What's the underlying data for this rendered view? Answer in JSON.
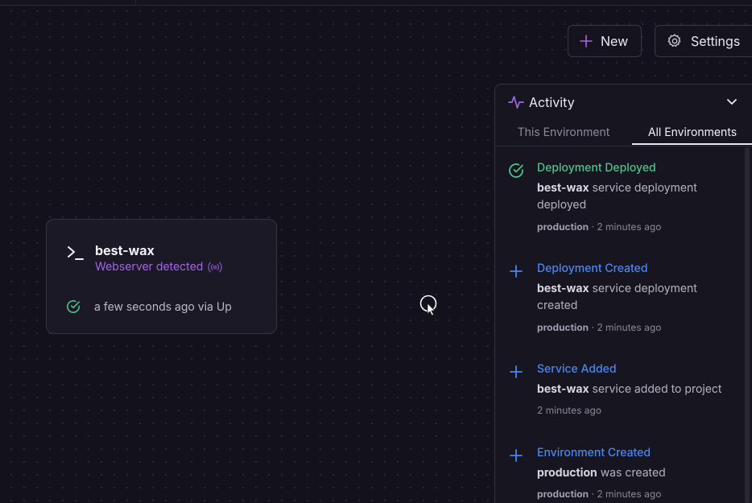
{
  "toolbar": {
    "new_label": "New",
    "settings_label": "Settings"
  },
  "service_card": {
    "name": "best-wax",
    "subtitle": "Webserver detected",
    "status_text": "a few seconds ago via Up",
    "icons": [
      "terminal-icon",
      "broadcast-icon",
      "check-circle-icon"
    ]
  },
  "activity": {
    "title": "Activity",
    "tabs": [
      {
        "label": "This Environment",
        "active": false
      },
      {
        "label": "All Environments",
        "active": true
      }
    ],
    "events": [
      {
        "icon": "check-circle-icon",
        "title": "Deployment Deployed",
        "subject": "best-wax",
        "text": "service deployment deployed",
        "env": "production",
        "time": "2 minutes ago"
      },
      {
        "icon": "plus-icon",
        "title": "Deployment Created",
        "subject": "best-wax",
        "text": "service deployment created",
        "env": "production",
        "time": "2 minutes ago"
      },
      {
        "icon": "plus-icon",
        "title": "Service Added",
        "subject": "best-wax",
        "text": "service added to project",
        "env": "",
        "time": "2 minutes ago"
      },
      {
        "icon": "plus-icon",
        "title": "Environment Created",
        "subject": "production",
        "text": "was created",
        "env": "production",
        "time": "2 minutes ago"
      }
    ]
  },
  "colors": {
    "background": "#13111c",
    "accent_purple": "#a565e8",
    "success_green": "#4ec28a",
    "info_blue": "#4b86f0"
  }
}
